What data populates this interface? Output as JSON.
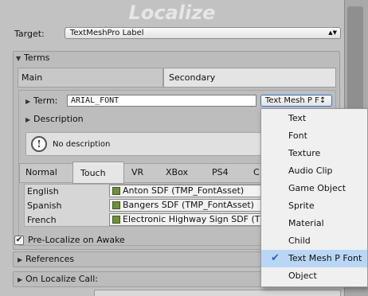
{
  "title": "Localize",
  "target": {
    "label": "Target:",
    "value": "TextMeshPro Label"
  },
  "terms_section": {
    "label": "Terms"
  },
  "tabs_top": [
    "Main",
    "Secondary"
  ],
  "term": {
    "label": "Term:",
    "value": "ARIAL_FONT",
    "type_value": "Text Mesh P F↕"
  },
  "description": {
    "label": "Description",
    "help_text": "No description"
  },
  "tabs_platform": [
    "Normal",
    "Touch",
    "VR",
    "XBox",
    "PS4",
    "C"
  ],
  "languages": [
    {
      "name": "English",
      "asset": "Anton SDF (TMP_FontAsset)"
    },
    {
      "name": "Spanish",
      "asset": "Bangers SDF (TMP_FontAsset)"
    },
    {
      "name": "French",
      "asset": "Electronic Highway Sign SDF (T"
    }
  ],
  "pre_localize": {
    "label": "Pre-Localize on Awake",
    "checked": true,
    "check_glyph": "✔"
  },
  "references": {
    "label": "References"
  },
  "on_localize_call": {
    "label": "On Localize Call:"
  },
  "menu": {
    "items": [
      "Text",
      "Font",
      "Texture",
      "Audio Clip",
      "Game Object",
      "Sprite",
      "Material",
      "Child",
      "Text Mesh P Font",
      "Object"
    ],
    "selected": "Text Mesh P Font",
    "check_glyph": "✔"
  },
  "icons": {
    "triangle_right": "▶",
    "triangle_down": "▼",
    "info": "!",
    "arrows": "▲▼"
  }
}
